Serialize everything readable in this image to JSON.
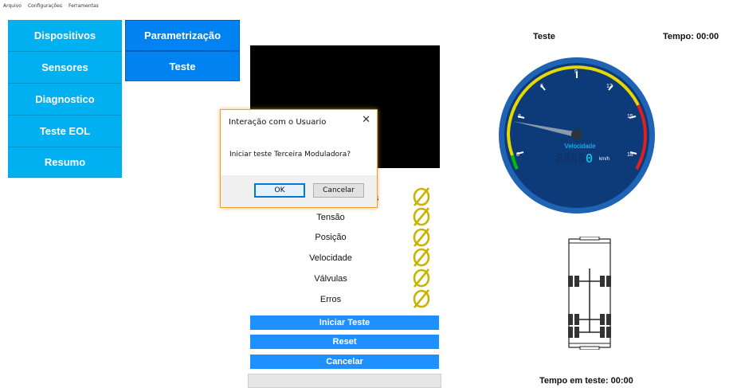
{
  "menu": {
    "items": [
      "Arquivo",
      "Configurações",
      "Ferramentas"
    ]
  },
  "nav": {
    "items": [
      "Dispositivos",
      "Sensores",
      "Diagnostico",
      "Teste EOL",
      "Resumo"
    ],
    "sub_items": [
      "Parametrização",
      "Teste"
    ]
  },
  "status": {
    "partial_label": "s",
    "rows": [
      "Tensão",
      "Posição",
      "Velocidade",
      "Válvulas",
      "Erros"
    ],
    "icon": "null-set-icon",
    "icon_color": "#c8b400"
  },
  "actions": {
    "start_label": "Iniciar Teste",
    "reset_label": "Reset",
    "cancel_label": "Cancelar"
  },
  "dialog": {
    "title": "Interação com o Usuario",
    "close_glyph": "✕",
    "message": "Iniciar teste Terceira Moduladora?",
    "ok_label": "OK",
    "cancel_label": "Cancelar"
  },
  "right": {
    "test_label": "Teste",
    "time_label": "Tempo: 00:00",
    "footer_time": "Tempo em teste: 00:00"
  },
  "gauge": {
    "title": "Velocidade",
    "unit": "km/h",
    "ghost_digits": "8888",
    "value_digit": "0",
    "tick_labels": [
      "0",
      "3",
      "6",
      "9",
      "12",
      "15",
      "18"
    ],
    "needle_value": 2.3,
    "colors": {
      "face": "#0d3a78",
      "rim": "#1f63b4",
      "green": "#00c000",
      "yellow": "#e6d800",
      "red": "#e02020"
    }
  }
}
